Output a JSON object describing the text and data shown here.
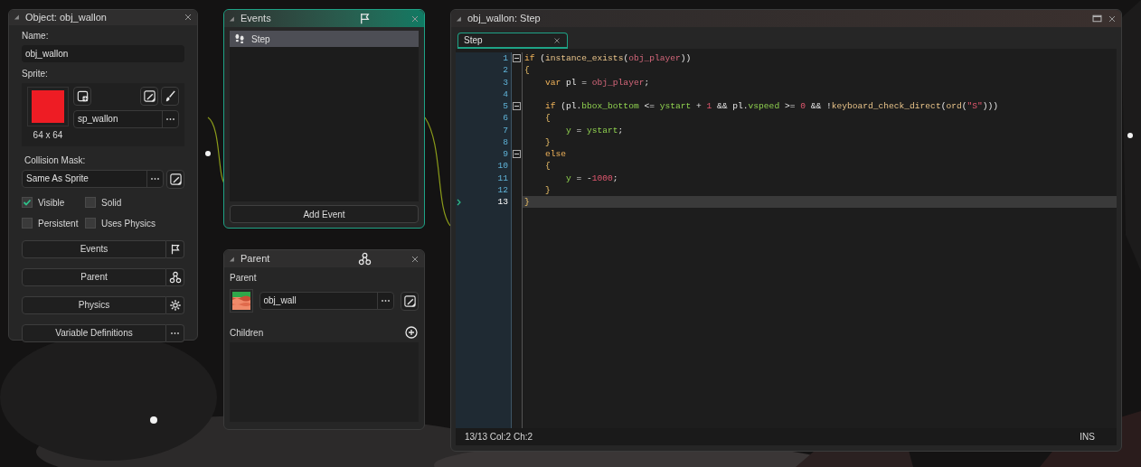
{
  "object_panel": {
    "title": "Object: obj_wallon",
    "name_label": "Name:",
    "name_value": "obj_wallon",
    "sprite_label": "Sprite:",
    "sprite_size": "64 x 64",
    "sprite_name": "sp_wallon",
    "collision_label": "Collision Mask:",
    "collision_value": "Same As Sprite",
    "checkboxes": [
      {
        "label": "Visible",
        "checked": true
      },
      {
        "label": "Solid",
        "checked": false
      },
      {
        "label": "Persistent",
        "checked": false
      },
      {
        "label": "Uses Physics",
        "checked": false
      }
    ],
    "buttons": [
      {
        "label": "Events",
        "kind": "flag"
      },
      {
        "label": "Parent",
        "kind": "parent"
      },
      {
        "label": "Physics",
        "kind": "gear"
      },
      {
        "label": "Variable Definitions",
        "kind": "more"
      }
    ]
  },
  "events_panel": {
    "title": "Events",
    "events": [
      {
        "label": "Step",
        "selected": true
      }
    ],
    "add_button": "Add Event"
  },
  "parent_panel": {
    "title": "Parent",
    "parent_label": "Parent",
    "parent_value": "obj_wall",
    "children_label": "Children"
  },
  "code_window": {
    "title": "obj_wallon: Step",
    "tabs": [
      {
        "label": "Step",
        "selected": true
      }
    ],
    "lines": [
      {
        "number": "1",
        "fold": true,
        "current": false,
        "tokens": [
          {
            "kind": "keyword",
            "text": "if"
          },
          {
            "kind": "plain",
            "text": " ("
          },
          {
            "kind": "function",
            "text": "instance_exists"
          },
          {
            "kind": "plain",
            "text": "("
          },
          {
            "kind": "object",
            "text": "obj_player"
          },
          {
            "kind": "plain",
            "text": "))"
          }
        ]
      },
      {
        "number": "2",
        "fold": false,
        "current": false,
        "tokens": [
          {
            "kind": "brace",
            "text": "{"
          }
        ],
        "children": [
          {
            "number": "3",
            "fold": false,
            "current": false,
            "tokens": [
              {
                "kind": "keyword",
                "text": "var"
              },
              {
                "kind": "plain",
                "text": " pl = "
              },
              {
                "kind": "object",
                "text": "obj_player"
              },
              {
                "kind": "plain",
                "text": ";"
              }
            ]
          },
          {
            "number": "4",
            "fold": false,
            "current": false
          },
          {
            "number": "5",
            "fold": true,
            "current": false,
            "tokens": [
              {
                "kind": "keyword",
                "text": "if"
              },
              {
                "kind": "plain",
                "text": " (pl."
              },
              {
                "kind": "variable",
                "text": "bbox_bottom"
              },
              {
                "kind": "plain",
                "text": " <= "
              },
              {
                "kind": "variable",
                "text": "ystart"
              },
              {
                "kind": "plain",
                "text": " + "
              },
              {
                "kind": "number",
                "text": "1"
              },
              {
                "kind": "plain",
                "text": " && pl."
              },
              {
                "kind": "variable",
                "text": "vspeed"
              },
              {
                "kind": "plain",
                "text": " >= "
              },
              {
                "kind": "number",
                "text": "0"
              },
              {
                "kind": "plain",
                "text": " && !"
              },
              {
                "kind": "function",
                "text": "keyboard_check_direct"
              },
              {
                "kind": "plain",
                "text": "("
              },
              {
                "kind": "function",
                "text": "ord"
              },
              {
                "kind": "plain",
                "text": "("
              },
              {
                "kind": "string",
                "text": "\"S\""
              },
              {
                "kind": "plain",
                "text": ")))"
              }
            ]
          },
          {
            "number": "6",
            "fold": false,
            "current": false,
            "tokens": [
              {
                "kind": "brace",
                "text": "{"
              }
            ],
            "children": [
              {
                "number": "7",
                "fold": false,
                "current": false,
                "tokens": [
                  {
                    "kind": "variable",
                    "text": "y"
                  },
                  {
                    "kind": "plain",
                    "text": " = "
                  },
                  {
                    "kind": "variable",
                    "text": "ystart"
                  },
                  {
                    "kind": "plain",
                    "text": ";"
                  }
                ]
              }
            ]
          },
          {
            "number": "8",
            "fold": false,
            "current": false,
            "tokens": [
              {
                "kind": "brace",
                "text": "}"
              }
            ]
          },
          {
            "number": "9",
            "fold": true,
            "current": false,
            "tokens": [
              {
                "kind": "keyword",
                "text": "else"
              }
            ]
          },
          {
            "number": "10",
            "fold": false,
            "current": false,
            "tokens": [
              {
                "kind": "brace",
                "text": "{"
              }
            ],
            "children": [
              {
                "number": "11",
                "fold": false,
                "current": false,
                "tokens": [
                  {
                    "kind": "variable",
                    "text": "y"
                  },
                  {
                    "kind": "plain",
                    "text": " = -"
                  },
                  {
                    "kind": "number",
                    "text": "1000"
                  },
                  {
                    "kind": "plain",
                    "text": ";"
                  }
                ]
              }
            ]
          },
          {
            "number": "12",
            "fold": false,
            "current": false,
            "tokens": [
              {
                "kind": "brace",
                "text": "}"
              }
            ]
          }
        ]
      },
      {
        "number": "13",
        "fold": false,
        "current": true,
        "tokens": [
          {
            "kind": "brace",
            "text": "}"
          }
        ]
      }
    ],
    "status": "13/13 Col:2 Ch:2",
    "mode": "INS"
  }
}
